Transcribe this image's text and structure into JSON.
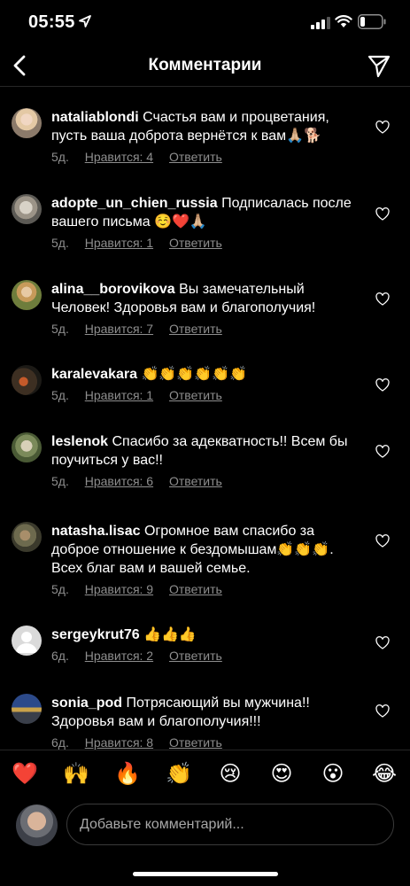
{
  "status_bar": {
    "time": "05:55"
  },
  "header": {
    "title": "Комментарии"
  },
  "comments": [
    {
      "username": "nataliablondi",
      "text": "Счастья вам и процветания, пусть ваша доброта вернётся к вам🙏🏼🐕",
      "age": "5д.",
      "likes": "Нравится: 4",
      "reply": "Ответить"
    },
    {
      "username": "adopte_un_chien_russia",
      "text": "Подписалась после вашего письма ☺️❤️🙏🏼",
      "age": "5д.",
      "likes": "Нравится: 1",
      "reply": "Ответить"
    },
    {
      "username": "alina__borovikova",
      "text": "Вы замечательный Человек! Здоровья вам и благополучия!",
      "age": "5д.",
      "likes": "Нравится: 7",
      "reply": "Ответить"
    },
    {
      "username": "karalevakara",
      "text": "👏👏👏👏👏👏",
      "age": "5д.",
      "likes": "Нравится: 1",
      "reply": "Ответить"
    },
    {
      "username": "leslenok",
      "text": "Спасибо за адекватность!! Всем бы поучиться у вас!!",
      "age": "5д.",
      "likes": "Нравится: 6",
      "reply": "Ответить"
    },
    {
      "username": "natasha.lisac",
      "text": "Огромное вам спасибо за доброе отношение к бездомышам👏👏👏. Всех благ вам и вашей семье.",
      "age": "5д.",
      "likes": "Нравится: 9",
      "reply": "Ответить"
    },
    {
      "username": "sergeykrut76",
      "text": "👍👍👍",
      "age": "6д.",
      "likes": "Нравится: 2",
      "reply": "Ответить"
    },
    {
      "username": "sonia_pod",
      "text": "Потрясающий вы мужчина!! Здоровья вам и благополучия!!!",
      "age": "6д.",
      "likes": "Нравится: 8",
      "reply": "Ответить"
    }
  ],
  "quick_reactions": [
    "❤️",
    "🙌",
    "🔥",
    "👏",
    "😢",
    "😍",
    "😮",
    "😂"
  ],
  "composer": {
    "placeholder": "Добавьте комментарий..."
  },
  "icons": {
    "status": [
      "location-arrow-icon",
      "signal-icon",
      "wifi-icon",
      "battery-icon"
    ],
    "header": [
      "back-icon",
      "send-icon"
    ],
    "comment": "heart-outline-icon"
  },
  "colors": {
    "background": "#000000",
    "secondary_text": "#8e8e8e",
    "divider": "#262626"
  }
}
